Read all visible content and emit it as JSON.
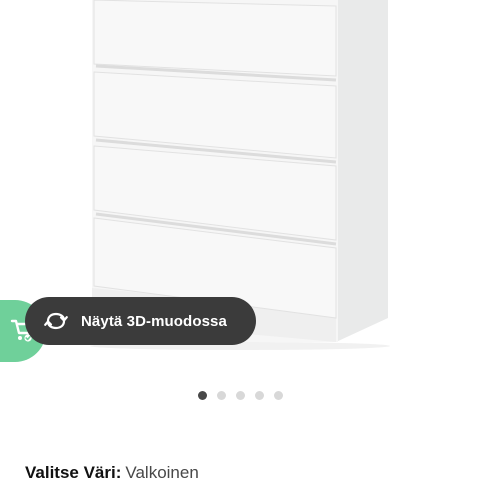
{
  "product": {
    "image_description_icon": "chest-of-drawers-product-image",
    "view_3d": {
      "label": "Näytä 3D-muodossa",
      "icon": "rotate-360-icon"
    },
    "cart_badge_icon": "cart-added-icon",
    "carousel": {
      "total": 5,
      "active_index": 0
    },
    "color": {
      "label": "Valitse Väri:",
      "value": "Valkoinen"
    }
  },
  "colors": {
    "button_bg": "#3b3b3b",
    "cart_badge_bg": "#6fd09a",
    "dot_active": "#484848",
    "dot_inactive": "#d8d8d8"
  }
}
